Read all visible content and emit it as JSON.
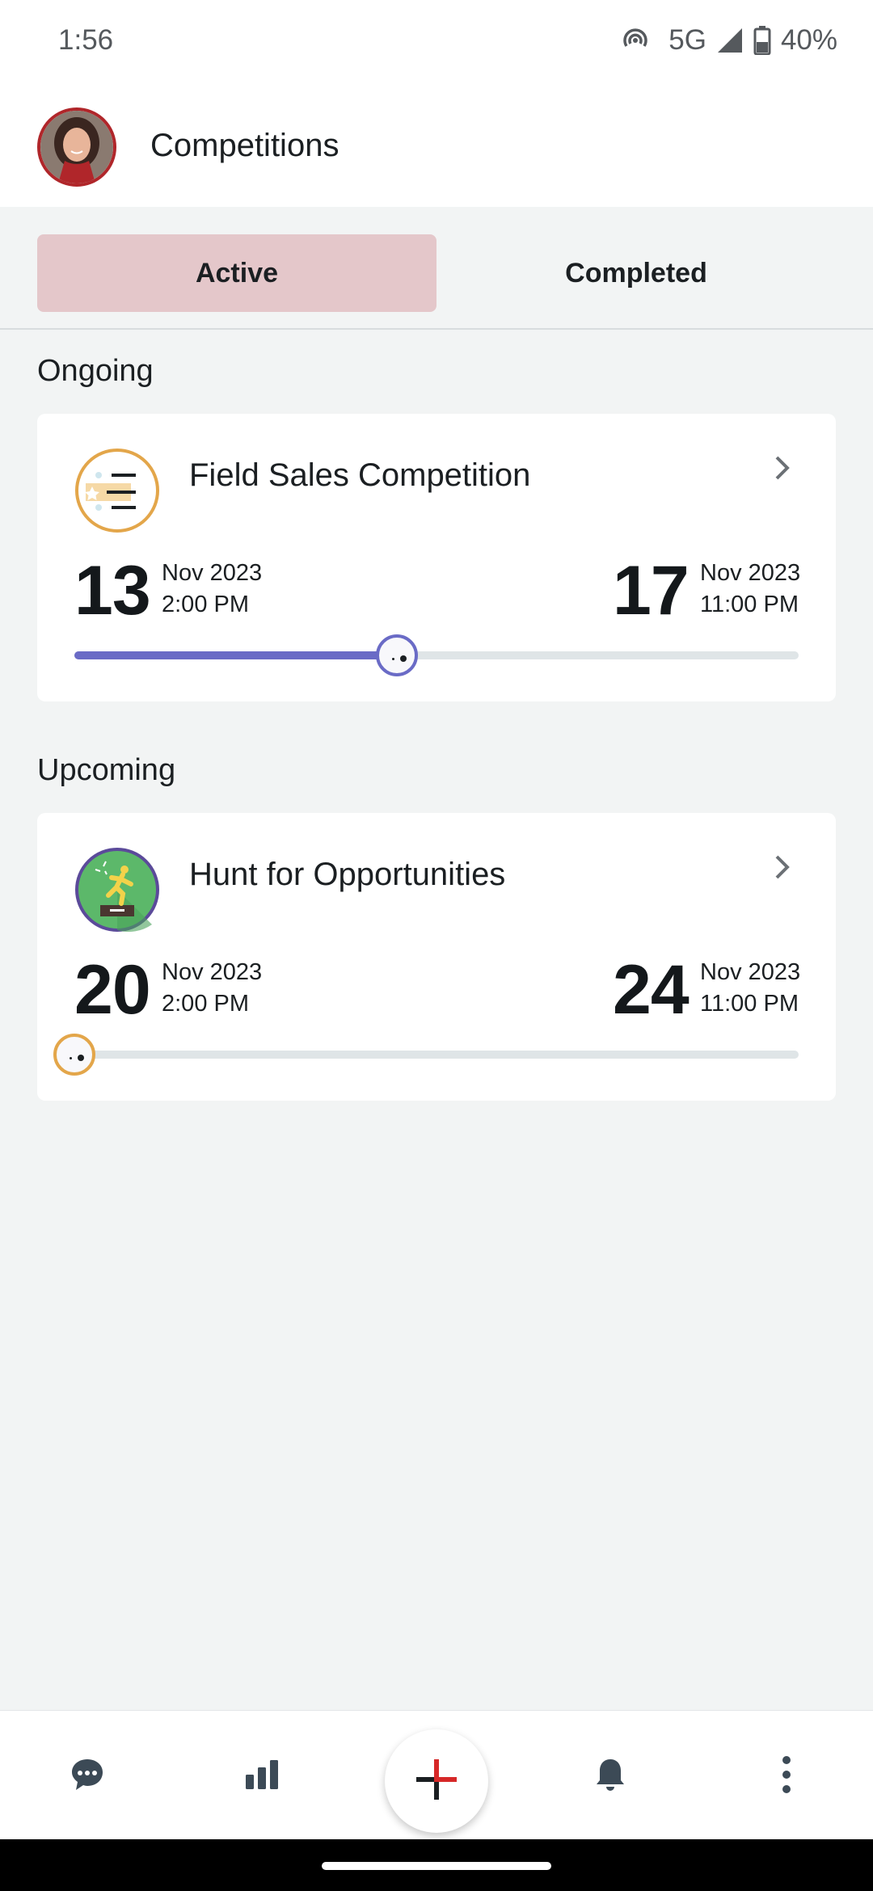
{
  "status_bar": {
    "time": "1:56",
    "network": "5G",
    "battery": "40%"
  },
  "header": {
    "title": "Competitions"
  },
  "tabs": [
    {
      "label": "Active",
      "selected": true
    },
    {
      "label": "Completed",
      "selected": false
    }
  ],
  "sections": {
    "ongoing": {
      "title": "Ongoing",
      "card": {
        "title": "Field Sales Competition",
        "icon": "list-badge-icon",
        "start": {
          "day": "13",
          "month_year": "Nov 2023",
          "time": "2:00 PM"
        },
        "end": {
          "day": "17",
          "month_year": "Nov 2023",
          "time": "11:00 PM"
        },
        "progress": 0.445,
        "accent": "#6a6bc6"
      }
    },
    "upcoming": {
      "title": "Upcoming",
      "card": {
        "title": "Hunt for Opportunities",
        "icon": "running-figure-icon",
        "start": {
          "day": "20",
          "month_year": "Nov 2023",
          "time": "2:00 PM"
        },
        "end": {
          "day": "24",
          "month_year": "Nov 2023",
          "time": "11:00 PM"
        },
        "progress": 0,
        "accent": "#e3a64a"
      }
    }
  },
  "bottom_nav": [
    "chat-icon",
    "leaderboard-icon",
    "add-icon",
    "notifications-icon",
    "more-vert-icon"
  ],
  "colors": {
    "active_tab": "#e4c7ca",
    "fab_plus": "#d62828"
  }
}
